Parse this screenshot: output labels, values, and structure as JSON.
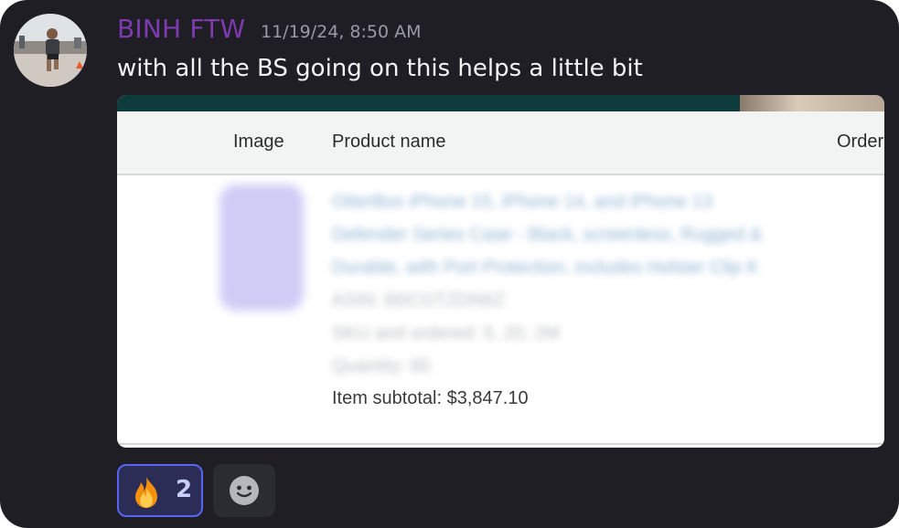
{
  "message": {
    "author": "BINH FTW",
    "timestamp": "11/19/24, 8:50 AM",
    "text": "with all the BS going on this helps a little bit"
  },
  "embed": {
    "columns": [
      "Image",
      "Product name",
      "Order"
    ],
    "blurred_lines": [
      "OtterBox iPhone 15, iPhone 14, and iPhone 13",
      "Defender Series Case - Black, screenless, Rugged &",
      "Durable, with Port Protection, includes Holster Clip K",
      "ASIN: B0CGTZDN6Z",
      "SKU and ordered: 5, 20, 2M",
      "Quantity: 65"
    ],
    "subtotal": "Item subtotal: $3,847.10"
  },
  "reactions": [
    {
      "emoji": "fire-icon",
      "count": "2"
    }
  ],
  "colors": {
    "background": "#1e1e24",
    "username": "#7e3bb1",
    "reaction_active": "#5865f2"
  }
}
